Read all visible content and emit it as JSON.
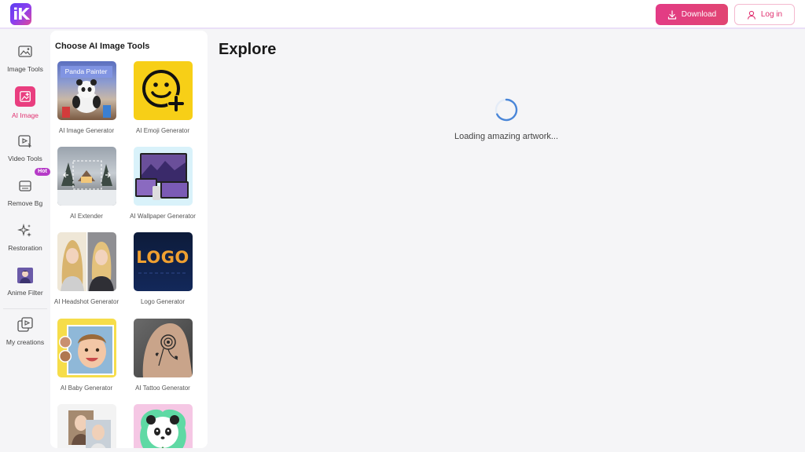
{
  "header": {
    "logo_text": "iK",
    "download_label": "Download",
    "login_label": "Log in"
  },
  "rail": {
    "items": [
      {
        "label": "Image Tools",
        "icon": "image-tools-icon"
      },
      {
        "label": "AI Image",
        "icon": "ai-image-icon",
        "active": true
      },
      {
        "label": "Video Tools",
        "icon": "video-tools-icon"
      },
      {
        "label": "Remove Bg",
        "icon": "remove-bg-icon"
      },
      {
        "label": "Restoration",
        "icon": "sparkle-icon"
      },
      {
        "label": "Anime Filter",
        "icon": "anime-filter-icon"
      },
      {
        "label": "My creations",
        "icon": "my-creations-icon"
      }
    ],
    "hot_badge": "Hot"
  },
  "panel": {
    "title": "Choose AI Image Tools",
    "tools": [
      {
        "name": "AI Image Generator",
        "thumb_text": "Panda Painter"
      },
      {
        "name": "AI Emoji Generator"
      },
      {
        "name": "AI Extender"
      },
      {
        "name": "AI Wallpaper Generator"
      },
      {
        "name": "AI Headshot Generator"
      },
      {
        "name": "Logo Generator",
        "thumb_text": "LOGO"
      },
      {
        "name": "AI Baby Generator"
      },
      {
        "name": "AI Tattoo Generator"
      },
      {
        "name": ""
      },
      {
        "name": ""
      }
    ]
  },
  "main": {
    "title": "Explore",
    "loading_text": "Loading amazing artwork..."
  },
  "colors": {
    "accent": "#e93e7f",
    "spinner": "#4a86d8"
  }
}
